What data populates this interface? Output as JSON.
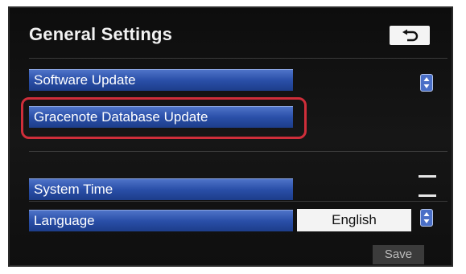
{
  "header": {
    "title": "General Settings",
    "back_icon": "return-arrow-icon"
  },
  "menu": {
    "items": [
      {
        "label": "Software Update"
      },
      {
        "label": "Gracenote Database Update",
        "highlighted": true
      },
      {
        "label": "System Time"
      },
      {
        "label": "Language",
        "value": "English"
      }
    ]
  },
  "footer": {
    "save_label": "Save"
  },
  "colors": {
    "screen_bg": "#111111",
    "item_blue": "#2a4fa8",
    "highlight_ring": "#cf2e3a"
  }
}
